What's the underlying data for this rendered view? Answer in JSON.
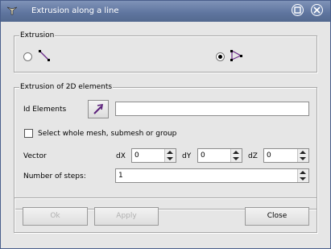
{
  "window": {
    "title": "Extrusion along a line"
  },
  "extrusion_group": {
    "legend": "Extrusion"
  },
  "elements_group": {
    "legend": "Extrusion of 2D elements",
    "id_elements_label": "Id Elements",
    "id_elements_value": "",
    "select_whole_mesh_label": "Select whole mesh, submesh or group",
    "vector_label": "Vector",
    "dx_label": "dX",
    "dx_value": "0",
    "dy_label": "dY",
    "dy_value": "0",
    "dz_label": "dZ",
    "dz_value": "0",
    "steps_label": "Number of steps:",
    "steps_value": "1"
  },
  "buttons": {
    "ok": "Ok",
    "apply": "Apply",
    "close": "Close"
  },
  "colors": {
    "titlebar": "#5e749e",
    "window_bg": "#e6e6e6"
  }
}
